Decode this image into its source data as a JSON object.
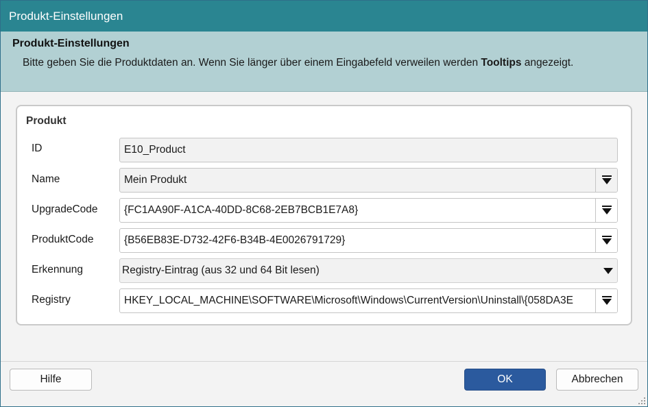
{
  "window": {
    "title": "Produkt-Einstellungen"
  },
  "header": {
    "title": "Produkt-Einstellungen",
    "desc_before": "Bitte geben Sie die Produktdaten an. Wenn Sie länger über einem Eingabefeld verweilen werden ",
    "desc_bold": "Tooltips",
    "desc_after": " angezeigt."
  },
  "group": {
    "title": "Produkt"
  },
  "fields": {
    "id": {
      "label": "ID",
      "value": "E10_Product"
    },
    "name": {
      "label": "Name",
      "value": "Mein Produkt"
    },
    "upgrade_code": {
      "label": "UpgradeCode",
      "value": "{FC1AA90F-A1CA-40DD-8C68-2EB7BCB1E7A8}"
    },
    "produkt_code": {
      "label": "ProduktCode",
      "value": "{B56EB83E-D732-42F6-B34B-4E0026791729}"
    },
    "erkennung": {
      "label": "Erkennung",
      "value": "Registry-Eintrag (aus 32 und 64 Bit lesen)"
    },
    "registry": {
      "label": "Registry",
      "value": "HKEY_LOCAL_MACHINE\\SOFTWARE\\Microsoft\\Windows\\CurrentVersion\\Uninstall\\{058DA3E"
    }
  },
  "footer": {
    "help_label": "Hilfe",
    "ok_label": "OK",
    "cancel_label": "Abbrechen"
  },
  "colors": {
    "titlebar": "#2a8591",
    "header_bg": "#b2d0d3",
    "primary_button": "#2b5a9e"
  },
  "icons": {
    "dropdown": "dropdown-bar-arrow-icon",
    "select": "chevron-down-icon",
    "resize": "resize-grip-icon"
  }
}
